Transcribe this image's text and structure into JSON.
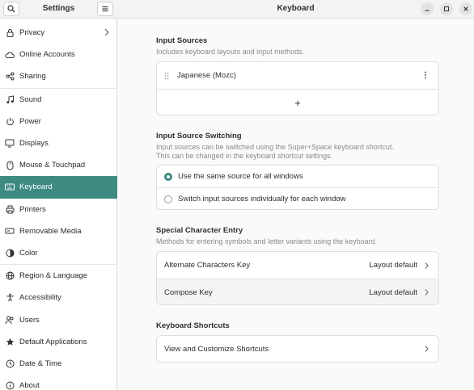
{
  "sidebar": {
    "title": "Settings",
    "items": [
      {
        "label": "Privacy",
        "icon": "lock-icon",
        "chevron": true
      },
      {
        "label": "Online Accounts",
        "icon": "cloud-icon"
      },
      {
        "label": "Sharing",
        "icon": "share-icon"
      },
      {
        "label": "Sound",
        "icon": "music-note-icon"
      },
      {
        "label": "Power",
        "icon": "power-icon"
      },
      {
        "label": "Displays",
        "icon": "display-icon"
      },
      {
        "label": "Mouse & Touchpad",
        "icon": "mouse-icon"
      },
      {
        "label": "Keyboard",
        "icon": "keyboard-icon",
        "active": true
      },
      {
        "label": "Printers",
        "icon": "printer-icon"
      },
      {
        "label": "Removable Media",
        "icon": "removable-media-icon"
      },
      {
        "label": "Color",
        "icon": "color-icon"
      },
      {
        "label": "Region & Language",
        "icon": "globe-icon"
      },
      {
        "label": "Accessibility",
        "icon": "accessibility-icon"
      },
      {
        "label": "Users",
        "icon": "users-icon"
      },
      {
        "label": "Default Applications",
        "icon": "star-icon"
      },
      {
        "label": "Date & Time",
        "icon": "clock-icon"
      },
      {
        "label": "About",
        "icon": "info-icon"
      }
    ]
  },
  "header": {
    "title": "Keyboard"
  },
  "input_sources": {
    "title": "Input Sources",
    "subtitle": "Includes keyboard layouts and input methods.",
    "source": "Japanese (Mozc)",
    "add_label": "+"
  },
  "switching": {
    "title": "Input Source Switching",
    "subtitle_line1": "Input sources can be switched using the Super+Space keyboard shortcut.",
    "subtitle_line2": "This can be changed in the keyboard shortcut settings.",
    "option1": "Use the same source for all windows",
    "option2": "Switch input sources individually for each window",
    "selected": 1
  },
  "special": {
    "title": "Special Character Entry",
    "subtitle": "Methods for entering symbols and letter variants using the keyboard.",
    "alt_label": "Alternate Characters Key",
    "alt_value": "Layout default",
    "compose_label": "Compose Key",
    "compose_value": "Layout default"
  },
  "shortcuts": {
    "title": "Keyboard Shortcuts",
    "row_label": "View and Customize Shortcuts"
  },
  "colors": {
    "accent": "#3d8a81"
  }
}
